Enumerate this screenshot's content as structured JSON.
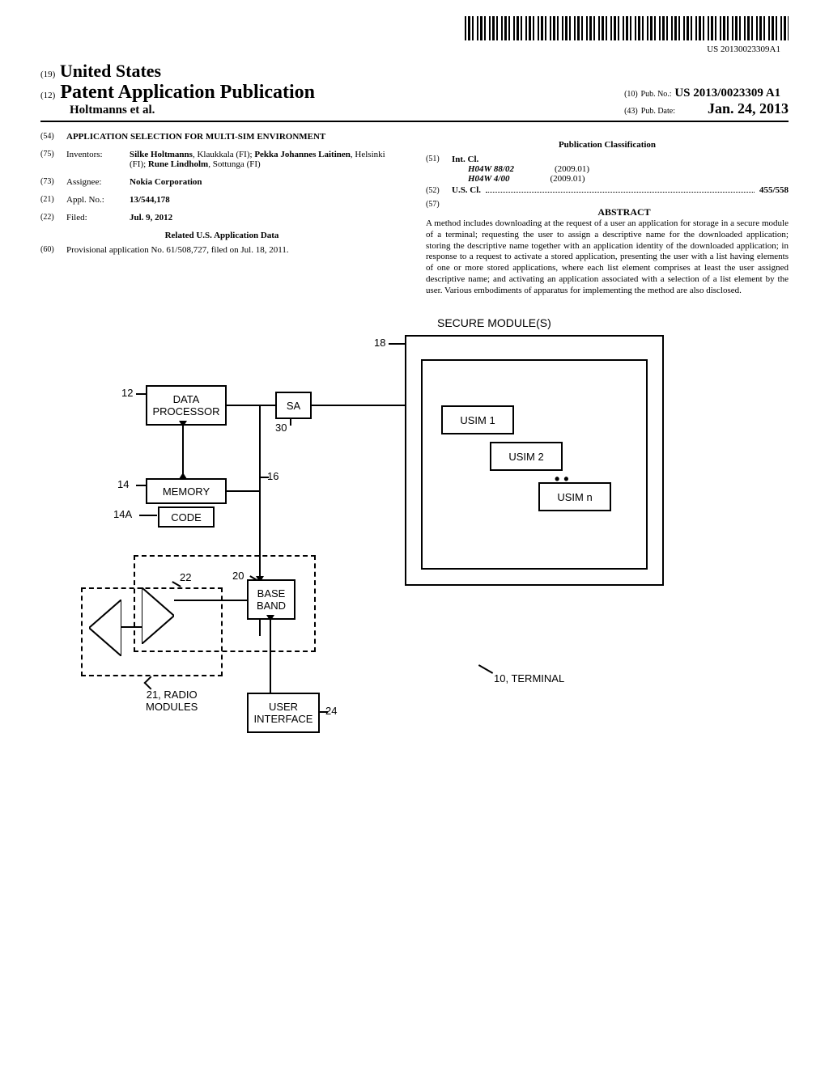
{
  "barcode_text": "US 20130023309A1",
  "header": {
    "country_code": "(19)",
    "country": "United States",
    "pub_code": "(12)",
    "pub_type": "Patent Application Publication",
    "authors": "Holtmanns et al.",
    "pubno_code": "(10)",
    "pubno_label": "Pub. No.:",
    "pubno": "US 2013/0023309 A1",
    "pubdate_code": "(43)",
    "pubdate_label": "Pub. Date:",
    "pubdate": "Jan. 24, 2013"
  },
  "left": {
    "title_code": "(54)",
    "title": "APPLICATION SELECTION FOR MULTI-SIM ENVIRONMENT",
    "inventors_code": "(75)",
    "inventors_label": "Inventors:",
    "inventors_html": "Silke Holtmanns, Klaukkala (FI); Pekka Johannes Laitinen, Helsinki (FI); Rune Lindholm, Sottunga (FI)",
    "inv1_name": "Silke Holtmanns",
    "inv1_loc": ", Klaukkala (FI); ",
    "inv2_name": "Pekka Johannes Laitinen",
    "inv2_loc": ", Helsinki (FI); ",
    "inv3_name": "Rune Lindholm",
    "inv3_loc": ", Sottunga (FI)",
    "assignee_code": "(73)",
    "assignee_label": "Assignee:",
    "assignee": "Nokia Corporation",
    "applno_code": "(21)",
    "applno_label": "Appl. No.:",
    "applno": "13/544,178",
    "filed_code": "(22)",
    "filed_label": "Filed:",
    "filed": "Jul. 9, 2012",
    "related_heading": "Related U.S. Application Data",
    "prov_code": "(60)",
    "prov_text": "Provisional application No. 61/508,727, filed on Jul. 18, 2011."
  },
  "right": {
    "pubclass_heading": "Publication Classification",
    "intcl_code": "(51)",
    "intcl_label": "Int. Cl.",
    "intcl1": "H04W 88/02",
    "intcl1_year": "(2009.01)",
    "intcl2": "H04W 4/00",
    "intcl2_year": "(2009.01)",
    "uscl_code": "(52)",
    "uscl_label": "U.S. Cl.",
    "uscl_value": "455/558",
    "abstract_code": "(57)",
    "abstract_heading": "ABSTRACT",
    "abstract": "A method includes downloading at the request of a user an application for storage in a secure module of a terminal; requesting the user to assign a descriptive name for the downloaded application; storing the descriptive name together with an application identity of the downloaded application; in response to a request to activate a stored application, presenting the user with a list having elements of one or more stored applications, where each list element comprises at least the user assigned descriptive name; and activating an application associated with a selection of a list element by the user. Various embodiments of apparatus for implementing the method are also disclosed."
  },
  "figure": {
    "secure_title": "SECURE MODULE(S)",
    "ref18": "18",
    "ref12": "12",
    "data_processor": "DATA\nPROCESSOR",
    "sa": "SA",
    "ref30": "30",
    "usim1": "USIM 1",
    "usim2": "USIM 2",
    "usimn": "USIM n",
    "ref14": "14",
    "memory": "MEMORY",
    "ref14a": "14A",
    "code": "CODE",
    "ref16": "16",
    "ref22": "22",
    "ref20": "20",
    "baseband": "BASE\nBAND",
    "ref21": "21, RADIO\nMODULES",
    "user_interface": "USER\nINTERFACE",
    "ref24": "24",
    "terminal": "10, TERMINAL"
  }
}
